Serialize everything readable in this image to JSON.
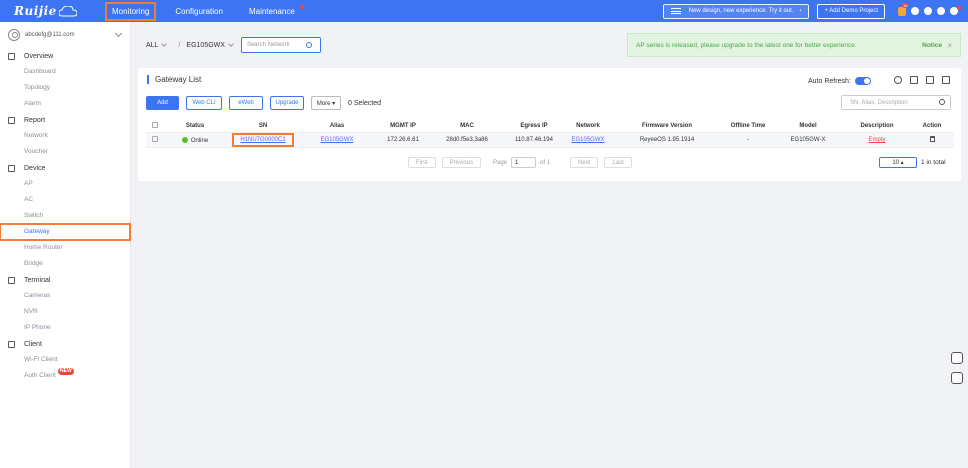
{
  "topbar": {
    "logo_text": "Ruijie",
    "nav": [
      "Monitoring",
      "Configuration",
      "Maintenance"
    ],
    "new_design": "New design, new experience. Try it out.",
    "demo_button": "+ Add Demo Project",
    "bell_count": "16"
  },
  "sidebar": {
    "account": "abcdefg@111.com",
    "overview": "Overview",
    "overview_items": [
      "Dashboard",
      "Topology",
      "Alarm"
    ],
    "report": "Report",
    "report_items": [
      "Network",
      "Voucher"
    ],
    "device": "Device",
    "device_items": [
      "AP",
      "AC",
      "Switch",
      "Gateway",
      "Home Router",
      "Bridge"
    ],
    "terminal": "Terminal",
    "terminal_items": [
      "Cameras",
      "NVR",
      "IP Phone"
    ],
    "client": "Client",
    "client_items": [
      "Wi-Fi Client",
      "Auth Client"
    ],
    "new_badge": "NEW"
  },
  "filter": {
    "scope": "ALL",
    "separator": "/",
    "network": "EG105GWX",
    "search_placeholder": "Search Network"
  },
  "notice": {
    "message": "AP series is released, please upgrade to the latest one for better experience.",
    "label": "Notice",
    "close": "×"
  },
  "card": {
    "title": "Gateway List",
    "auto_refresh": "Auto Refresh:",
    "buttons": [
      "Add",
      "Web CLI",
      "eWeb",
      "Upgrade",
      "More ▾"
    ],
    "selected": "0 Selected",
    "search_placeholder": "SN, Alias, Description"
  },
  "table": {
    "headers": [
      "Status",
      "SN",
      "Alias",
      "MGMT IP",
      "MAC",
      "Egress IP",
      "Network",
      "Firmware Version",
      "Offline Time",
      "Model",
      "Description",
      "Action"
    ],
    "row": {
      "status": "Online",
      "sn": "H1NU7G0000C1",
      "alias": "EG105GWX",
      "mgmt_ip": "172.26.6.61",
      "mac": "28d0.f5e3.3a86",
      "egress_ip": "110.87.46.194",
      "network": "EG105GWX",
      "firmware": "ReyeeOS 1.95.1914",
      "offline_time": "-",
      "model": "EG105GW-X",
      "description": "Empty"
    }
  },
  "pager": {
    "first": "First",
    "previous": "Previous",
    "page_label": "Page",
    "page_value": "1",
    "of": "of 1",
    "next": "Next",
    "last": "Last",
    "page_size": "10 ▴",
    "total": "1 in total"
  }
}
